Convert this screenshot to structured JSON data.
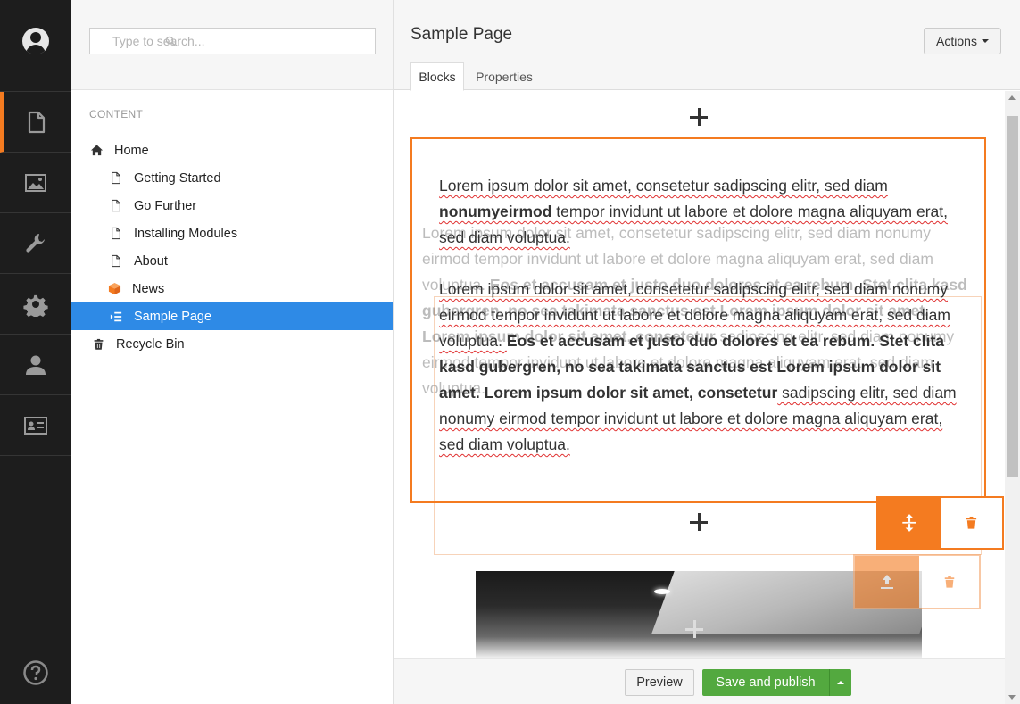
{
  "sections": [
    {
      "name": "content",
      "icon": "document-icon"
    },
    {
      "name": "media",
      "icon": "image-icon"
    },
    {
      "name": "developer",
      "icon": "wrench-icon"
    },
    {
      "name": "settings",
      "icon": "gear-icon"
    },
    {
      "name": "users",
      "icon": "user-icon"
    },
    {
      "name": "members",
      "icon": "id-card-icon"
    }
  ],
  "search": {
    "placeholder": "Type to search..."
  },
  "tree": {
    "section_title": "CONTENT",
    "nodes": [
      {
        "label": "Home",
        "icon": "home-icon"
      },
      {
        "label": "Getting Started",
        "icon": "page-icon"
      },
      {
        "label": "Go Further",
        "icon": "page-icon"
      },
      {
        "label": "Installing Modules",
        "icon": "page-icon"
      },
      {
        "label": "About",
        "icon": "page-icon"
      },
      {
        "label": "News",
        "icon": "box-icon"
      },
      {
        "label": "Sample Page",
        "icon": "list-icon",
        "selected": true
      },
      {
        "label": "Recycle Bin",
        "icon": "trash-icon"
      }
    ]
  },
  "editor": {
    "title": "Sample Page",
    "actions_label": "Actions",
    "tabs": [
      {
        "label": "Blocks",
        "active": true
      },
      {
        "label": "Properties"
      }
    ],
    "block": {
      "p1": {
        "a": "Lorem ipsum dolor sit amet, consetetur sadipscing elitr, sed diam ",
        "b": "nonumyeirmod",
        "c": " tempor invidunt ut labore et dolore magna aliquyam erat, sed diam voluptua."
      },
      "p2": {
        "plain": "Lorem ipsum dolor sit amet, consetetur sadipscing elitr, sed diam nonumy eirmod tempor invidunt ut labore et dolore magna aliquyam erat, sed diam voluptua. ",
        "bold": "Eos et accusam et justo duo dolores et ea rebum. Stet clita kasd gubergren, no sea takimata sanctus est Lorem ipsum dolor sit amet. Lorem ipsum dolor sit amet, consetetur",
        "rest": " sadipscing elitr, sed diam nonumy eirmod tempor invidunt ut labore et dolore magna aliquyam erat, sed diam voluptua."
      }
    },
    "ghost": {
      "plain": "Lorem ipsum dolor sit amet, consetetur sadipscing elitr, sed diam nonumy eirmod tempor invidunt ut labore et dolore magna aliquyam erat, sed diam voluptua. ",
      "bold": "Eos et accusam et justo duo dolores et ea rebum. Stet clita kasd gubergren, no sea takimata sanctus est Lorem ipsum dolor sit amet. Lorem ipsum dolor sit amet, consetetur",
      "rest": " sadipscing elitr, sed diam nonumy eirmod tempor invidunt ut labore et dolore magna aliquyam erat, sed diam voluptua."
    }
  },
  "footer": {
    "preview_label": "Preview",
    "publish_label": "Save and publish"
  },
  "colors": {
    "accent": "#f47b20",
    "selected": "#2e8ae6",
    "publish": "#53a93f",
    "appbar": "#1d1d1d"
  }
}
